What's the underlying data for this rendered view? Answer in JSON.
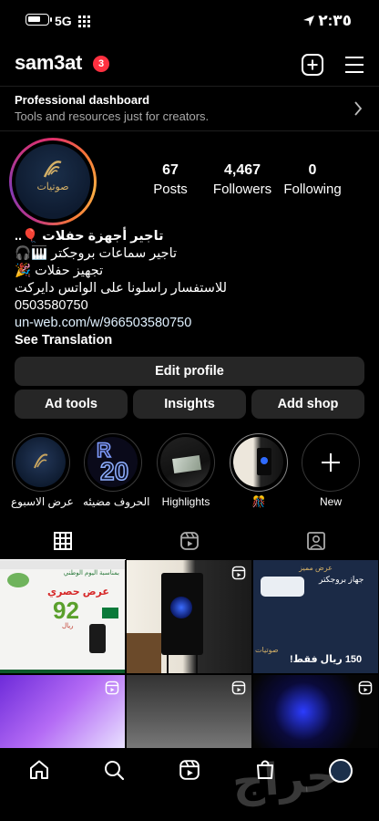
{
  "status_bar": {
    "network": "5G",
    "time": "٢:٣٥"
  },
  "header": {
    "username": "sam3at",
    "notification_count": "3"
  },
  "dashboard": {
    "title": "Professional dashboard",
    "subtitle": "Tools and resources just for creators."
  },
  "avatar": {
    "logo_text": "صوتيات"
  },
  "stats": {
    "posts": {
      "value": "67",
      "label": "Posts"
    },
    "followers": {
      "value": "4,467",
      "label": "Followers"
    },
    "following": {
      "value": "0",
      "label": "Following"
    }
  },
  "bio": {
    "line1": "تاجير أجهزة حفلات 🎈..",
    "line2": "تاجير سماعات بروجكتر 🎹🎧",
    "line3": "تجهيز حفلات 🎉",
    "line4": "للاستفسار راسلونا على الواتس دايركت",
    "phone": "0503580750",
    "link": "un-web.com/w/966503580750",
    "see_translation": "See Translation"
  },
  "buttons": {
    "edit_profile": "Edit profile",
    "ad_tools": "Ad tools",
    "insights": "Insights",
    "add_shop": "Add shop"
  },
  "highlights": [
    {
      "label": "عرض الاسبوع"
    },
    {
      "label": "الحروف مضيئه"
    },
    {
      "label": "Highlights"
    },
    {
      "label": "🎊"
    },
    {
      "label": "New"
    }
  ],
  "grid": {
    "post1": {
      "title": "بمناسبة اليوم الوطني",
      "offer": "عرض حصري",
      "price": "92",
      "currency": "ريال"
    },
    "post3": {
      "title": "عرض مميز",
      "item": "جهاز بروجكتر",
      "price": "150 ريال فقط!",
      "brand": "صوتيات"
    }
  },
  "watermark": "حراج",
  "colors": {
    "badge": "#ff3040",
    "button_bg": "#262626",
    "link": "#e0f1ff"
  }
}
